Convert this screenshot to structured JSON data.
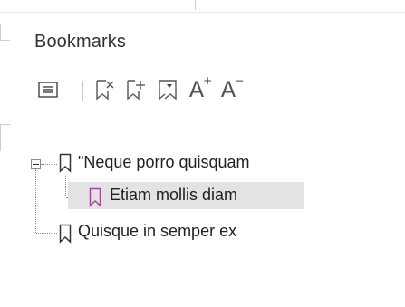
{
  "panel": {
    "title": "Bookmarks"
  },
  "toolbar": {
    "buttons": [
      {
        "name": "options-menu-button",
        "icon": "list-menu-icon"
      },
      {
        "name": "delete-bookmark-button",
        "icon": "bookmark-delete-icon"
      },
      {
        "name": "add-bookmark-button",
        "icon": "bookmark-add-icon"
      },
      {
        "name": "expand-bookmark-button",
        "icon": "bookmark-expand-icon"
      },
      {
        "name": "increase-font-button",
        "text": "A",
        "mark": "+"
      },
      {
        "name": "decrease-font-button",
        "text": "A",
        "mark": "−"
      }
    ]
  },
  "tree": {
    "nodes": [
      {
        "label": "\"Neque porro quisquam",
        "level": 0,
        "expanded": true,
        "selected": false,
        "icon_color": "#333333"
      },
      {
        "label": "Etiam mollis diam",
        "level": 1,
        "expanded": false,
        "selected": true,
        "icon_color": "#b43fa8"
      },
      {
        "label": "Quisque in semper ex",
        "level": 0,
        "expanded": false,
        "selected": false,
        "icon_color": "#333333"
      }
    ]
  },
  "colors": {
    "selection": "#e3e3e3",
    "accent_icon": "#b43fa8"
  }
}
